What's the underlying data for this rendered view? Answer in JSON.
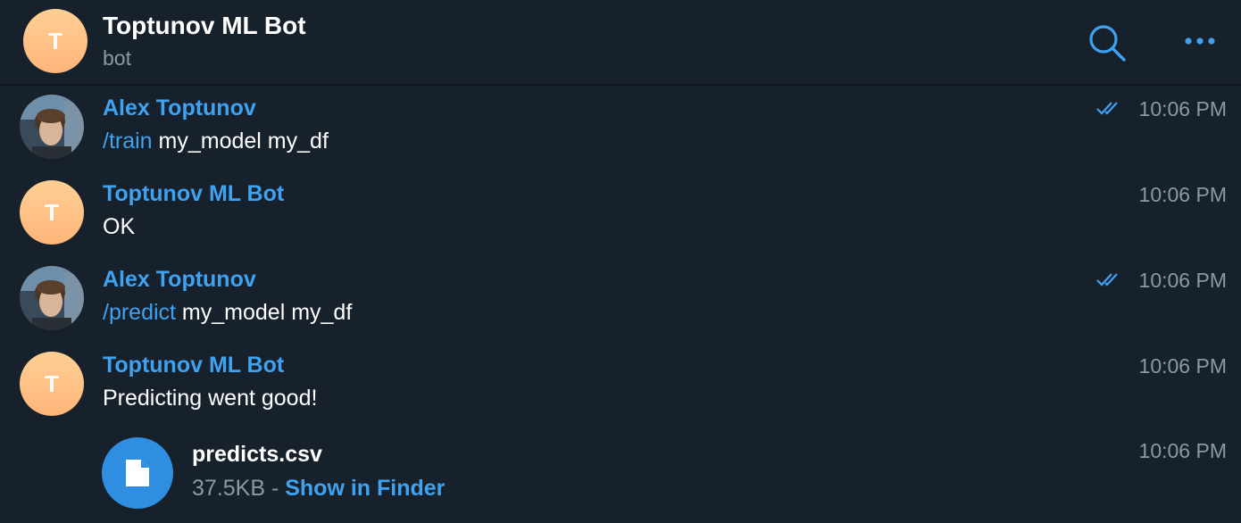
{
  "header": {
    "avatar_letter": "T",
    "title": "Toptunov ML Bot",
    "subtitle": "bot",
    "search_icon": "search-icon",
    "more_icon": "more-horizontal-icon"
  },
  "messages": [
    {
      "sender": "Alex Toptunov",
      "command": "/train",
      "text": " my_model my_df",
      "time": "10:06 PM",
      "read": true
    },
    {
      "sender": "Toptunov ML Bot",
      "avatar_letter": "T",
      "text": "OK",
      "time": "10:06 PM"
    },
    {
      "sender": "Alex Toptunov",
      "command": "/predict",
      "text": " my_model my_df",
      "time": "10:06 PM",
      "read": true
    },
    {
      "sender": "Toptunov ML Bot",
      "avatar_letter": "T",
      "text": "Predicting went good!",
      "time": "10:06 PM"
    }
  ],
  "file": {
    "name": "predicts.csv",
    "size": "37.5KB",
    "separator": " - ",
    "action": "Show in Finder",
    "time": "10:06 PM",
    "icon": "document-icon"
  },
  "colors": {
    "background": "#17212b",
    "accent": "#3fa2f0",
    "muted": "#8a98a7",
    "avatar_gradient_top": "#ffcf94",
    "avatar_gradient_bottom": "#ffb57a",
    "file_icon_bg": "#2f8ee0"
  }
}
